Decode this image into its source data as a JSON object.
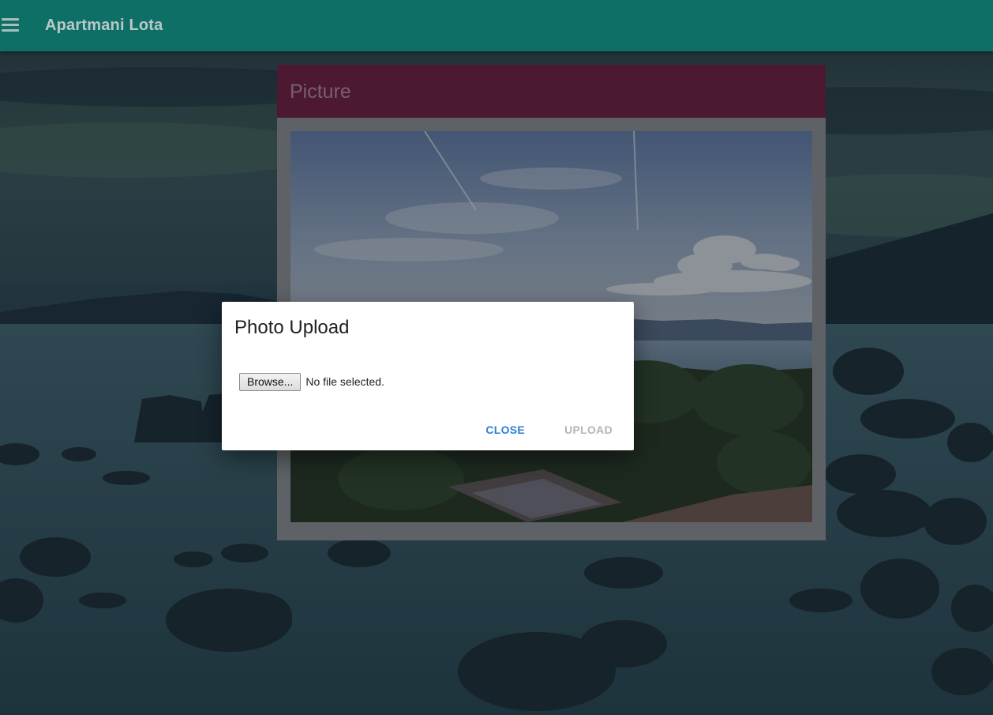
{
  "appbar": {
    "title": "Apartmani Lota",
    "menu_icon": "hamburger-menu-icon",
    "color": "#0e6f66"
  },
  "card": {
    "title": "Picture",
    "header_color": "#7e1d42"
  },
  "dialog": {
    "title": "Photo Upload",
    "browse_label": "Browse...",
    "file_status": "No file selected.",
    "close_label": "CLOSE",
    "upload_label": "UPLOAD",
    "close_color": "#2a7fd9",
    "upload_color": "#b4b4b4"
  }
}
